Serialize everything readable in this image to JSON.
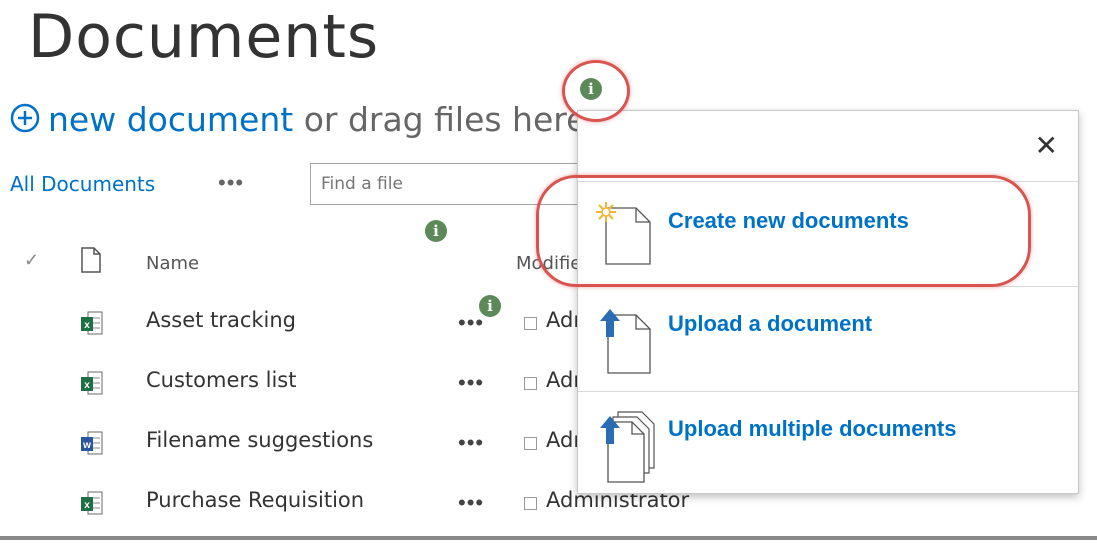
{
  "page": {
    "title": "Documents",
    "new_document_label": "new document",
    "new_document_suffix": " or drag files here"
  },
  "toolbar": {
    "view_label": "All Documents",
    "more_label": "•••",
    "search_placeholder": "Find a file"
  },
  "columns": {
    "check": "✓",
    "name": "Name",
    "modified_by": "Modified By"
  },
  "rows": [
    {
      "name": "Asset tracking",
      "modified_by": "Administrator",
      "type": "excel-icon"
    },
    {
      "name": "Customers list",
      "modified_by": "Administrator",
      "type": "excel-icon"
    },
    {
      "name": "Filename suggestions",
      "modified_by": "Administrator",
      "type": "word-icon"
    },
    {
      "name": "Purchase Requisition",
      "modified_by": "Administrator",
      "type": "excel-icon"
    }
  ],
  "row_more": "•••",
  "panel": {
    "close": "✕",
    "items": [
      {
        "label": "Create new documents",
        "icon": "new-document-icon"
      },
      {
        "label": "Upload a document",
        "icon": "upload-document-icon"
      },
      {
        "label": "Upload multiple documents",
        "icon": "upload-multiple-documents-icon"
      }
    ]
  },
  "info_glyph": "i",
  "colors": {
    "link": "#0072c6",
    "highlight": "#d9534f",
    "info": "#5b8a58"
  }
}
